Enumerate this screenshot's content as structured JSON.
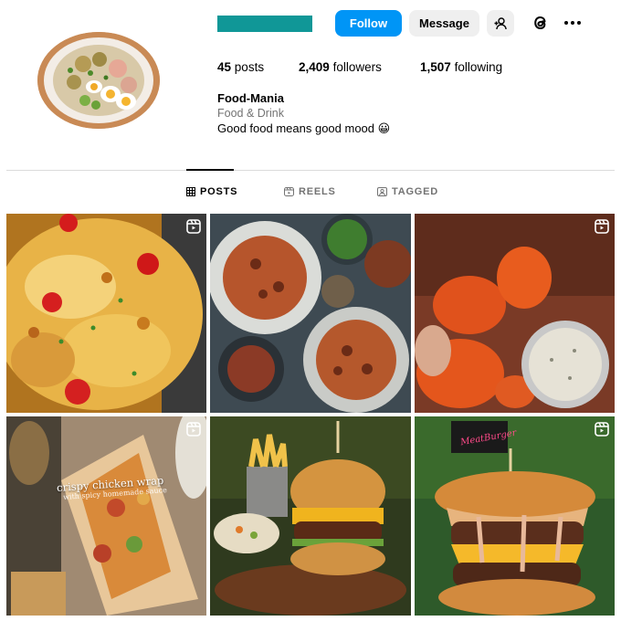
{
  "header": {
    "follow_label": "Follow",
    "message_label": "Message",
    "redacted_color": "#109797"
  },
  "stats": {
    "posts_count": "45",
    "posts_label": "posts",
    "followers_count": "2,409",
    "followers_label": "followers",
    "following_count": "1,507",
    "following_label": "following"
  },
  "bio": {
    "name": "Food-Mania",
    "category": "Food & Drink",
    "text": "Good food means good mood 😀"
  },
  "tabs": [
    {
      "label": "POSTS",
      "active": true,
      "icon": "grid-icon"
    },
    {
      "label": "REELS",
      "active": false,
      "icon": "reels-icon"
    },
    {
      "label": "TAGGED",
      "active": false,
      "icon": "tagged-icon"
    }
  ],
  "posts": [
    {
      "subject": "cheesy chicken casserole",
      "is_reel": true
    },
    {
      "subject": "spaghetti and meatballs spread",
      "is_reel": false
    },
    {
      "subject": "buffalo chicken bites with dip",
      "is_reel": true
    },
    {
      "subject": "crispy chicken wrap",
      "is_reel": true,
      "overlay_title": "crispy chicken wrap",
      "overlay_sub": "with spicy homemade sauce"
    },
    {
      "subject": "burger with fries and coleslaw",
      "is_reel": false
    },
    {
      "subject": "double cheeseburger",
      "is_reel": true,
      "sign_text": "MeatBurger"
    }
  ],
  "colors": {
    "primary_blue": "#0095f6",
    "button_gray": "#efefef",
    "muted_text": "#737373",
    "divider": "#dbdbdb"
  }
}
